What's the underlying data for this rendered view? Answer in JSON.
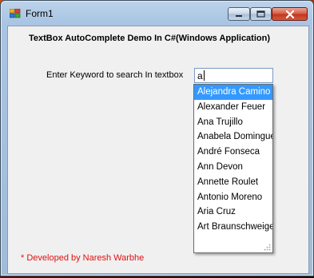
{
  "window": {
    "title": "Form1",
    "heading": "TextBox AutoComplete Demo In C#(Windows Application)",
    "search_label": "Enter Keyword to search In textbox",
    "search_value": "a",
    "footer": "* Developed by Naresh Warbhe"
  },
  "autocomplete": {
    "items": [
      "Alejandra Camino",
      "Alexander Feuer",
      "Ana Trujillo",
      "Anabela Domingues",
      "André Fonseca",
      "Ann Devon",
      "Annette Roulet",
      "Antonio Moreno",
      "Aria Cruz",
      "Art Braunschweiger"
    ],
    "selected_index": 0
  },
  "colors": {
    "selection": "#3399ff",
    "footer_text": "#e01010",
    "close_button": "#c2381f"
  },
  "icons": [
    "app-icon",
    "minimize-icon",
    "maximize-icon",
    "close-icon",
    "resize-grip-icon"
  ]
}
